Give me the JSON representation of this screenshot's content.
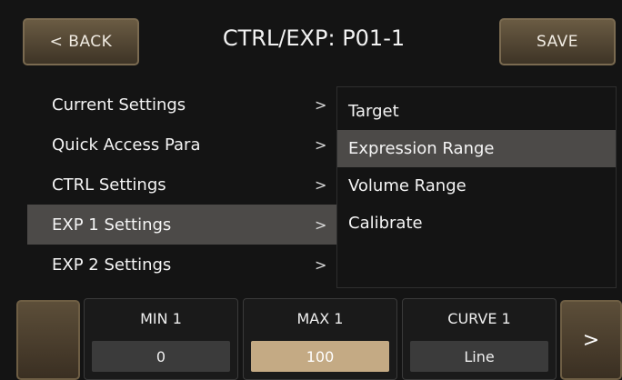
{
  "header": {
    "back_label": "< BACK",
    "title": "CTRL/EXP: P01-1",
    "save_label": "SAVE"
  },
  "menu_left": {
    "items": [
      {
        "label": "Current Settings",
        "chevron": ">"
      },
      {
        "label": "Quick Access Para",
        "chevron": ">"
      },
      {
        "label": "CTRL Settings",
        "chevron": ">"
      },
      {
        "label": "EXP 1 Settings",
        "chevron": ">"
      },
      {
        "label": "EXP 2 Settings",
        "chevron": ">"
      }
    ],
    "selected": "EXP 1 Settings"
  },
  "menu_right": {
    "items": [
      {
        "label": "Target"
      },
      {
        "label": "Expression Range"
      },
      {
        "label": "Volume Range"
      },
      {
        "label": "Calibrate"
      }
    ],
    "selected": "Expression Range"
  },
  "params": {
    "min": {
      "label": "MIN 1",
      "value": "0"
    },
    "max": {
      "label": "MAX 1",
      "value": "100"
    },
    "curve": {
      "label": "CURVE 1",
      "value": "Line"
    }
  },
  "nav": {
    "next_label": ">"
  },
  "colors": {
    "accent": "#c4aa84",
    "selection": "#4c4a48",
    "button": "#5c4e39"
  }
}
